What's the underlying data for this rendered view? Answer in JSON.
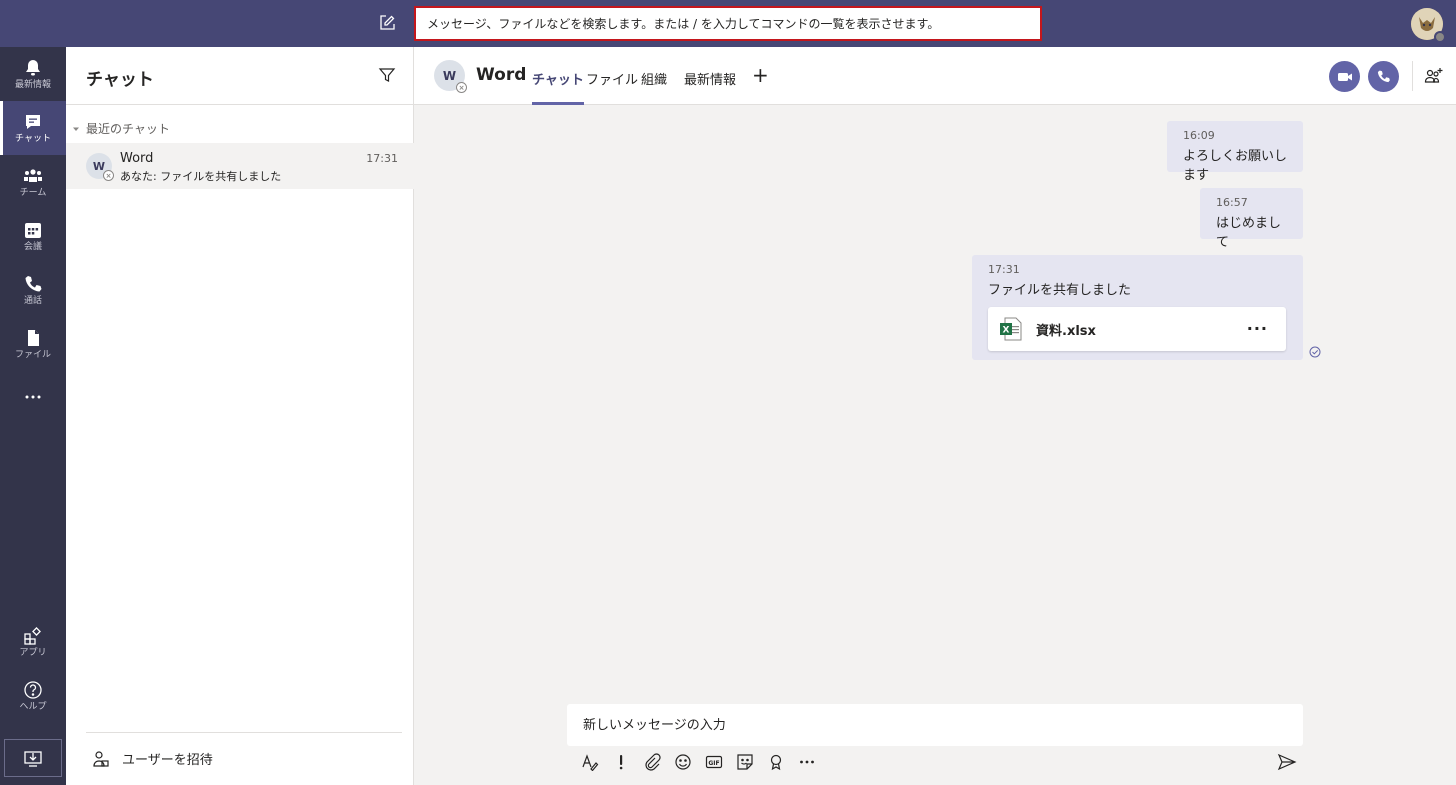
{
  "search": {
    "placeholder": "メッセージ、ファイルなどを検索します。または / を入力してコマンドの一覧を表示させます。"
  },
  "rail": {
    "items": [
      {
        "label": "最新情報",
        "icon": "bell-icon"
      },
      {
        "label": "チャット",
        "icon": "chat-icon",
        "active": true
      },
      {
        "label": "チーム",
        "icon": "teams-icon"
      },
      {
        "label": "会議",
        "icon": "calendar-icon"
      },
      {
        "label": "通話",
        "icon": "phone-icon"
      },
      {
        "label": "ファイル",
        "icon": "file-icon"
      }
    ],
    "bottom": [
      {
        "label": "アプリ",
        "icon": "apps-icon"
      },
      {
        "label": "ヘルプ",
        "icon": "help-icon"
      }
    ]
  },
  "chat_list": {
    "title": "チャット",
    "section": "最近のチャット",
    "items": [
      {
        "avatar": "W",
        "name": "Word",
        "time": "17:31",
        "preview": "あなた: ファイルを共有しました"
      }
    ],
    "invite": "ユーザーを招待"
  },
  "conversation": {
    "avatar": "W",
    "title": "Word",
    "tabs": [
      "チャット",
      "ファイル",
      "組織",
      "最新情報"
    ],
    "messages": [
      {
        "time": "16:09",
        "text": "よろしくお願いします"
      },
      {
        "time": "16:57",
        "text": "はじめまして"
      },
      {
        "time": "17:31",
        "text": "ファイルを共有しました",
        "file": {
          "name": "資料.xlsx",
          "icon": "excel-icon"
        }
      }
    ]
  },
  "compose": {
    "placeholder": "新しいメッセージの入力"
  },
  "colors": {
    "topbar": "#464775",
    "rail": "#33344a",
    "accent": "#6264a7",
    "message_bg": "#e5e5f1",
    "search_border": "#c4161c"
  }
}
